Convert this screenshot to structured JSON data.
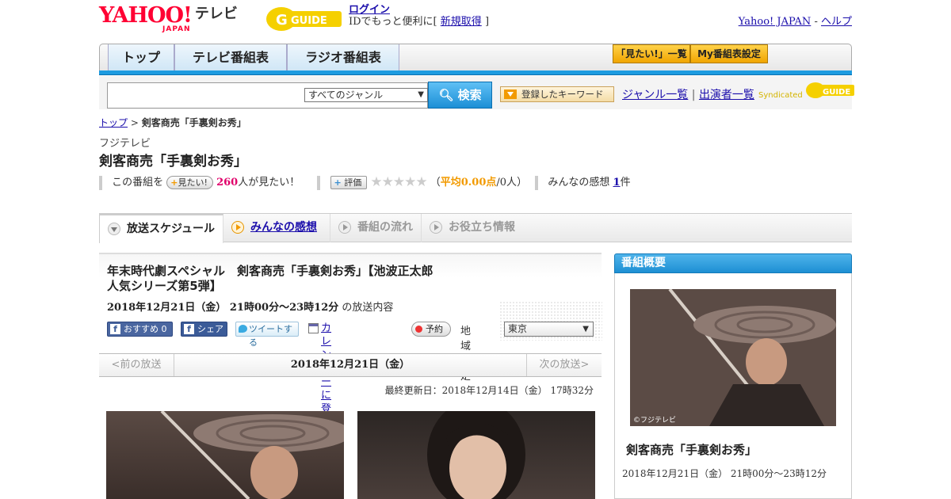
{
  "header": {
    "yahoo_logo": "YAHOO!",
    "yahoo_sub": "JAPAN",
    "tv_label": "テレビ",
    "gguide_logo": "G GUIDE",
    "login_label": "ログイン",
    "login_note_prefix": "IDでもっと便利に[",
    "signup_label": "新規取得",
    "login_note_suffix": "]",
    "yahoo_japan_link": "Yahoo! JAPAN",
    "link_separator": "-",
    "help_link": "ヘルプ"
  },
  "nav": {
    "tabs": [
      "トップ",
      "テレビ番組表",
      "ラジオ番組表"
    ],
    "want_list": "「見たい!」一覧",
    "my_schedule": "My番組表設定"
  },
  "search": {
    "placeholder": "",
    "genre_selected": "すべてのジャンル",
    "search_button": "検索",
    "keyword_button": "登録したキーワード",
    "genre_list_link": "ジャンル一覧",
    "divider": "|",
    "cast_list_link": "出演者一覧",
    "syndicated_label": "Syndicated",
    "syndicated_logo": "GUIDE"
  },
  "breadcrumb": {
    "home": "トップ",
    "separator": ">",
    "current": "剣客商売「手裏剣お秀」"
  },
  "program": {
    "station": "フジテレビ",
    "title": "剣客商売「手裏剣お秀」",
    "want_prefix": "この番組を",
    "want_button": "見たい!",
    "want_count": "260",
    "want_suffix": "人が見たい！",
    "rate_button": "評価",
    "stars": "★★★★★",
    "rating_open": "（",
    "rating_avg": "平均0.00点",
    "rating_count": "/0人",
    "rating_close": "）",
    "impressions_label": "みんなの感想",
    "impressions_count": "1",
    "impressions_unit": "件"
  },
  "tabs": [
    {
      "label": "放送スケジュール"
    },
    {
      "label": "みんなの感想"
    },
    {
      "label": "番組の流れ"
    },
    {
      "label": "お役立ち情報"
    }
  ],
  "broadcast": {
    "title_line1": "年末時代劇スペシャル　剣客商売「手裏剣お秀」【池波正太郎",
    "title_line2": "人気シリーズ第5弾】",
    "datetime": "2018年12月21日（金）  21時00分～23時12分",
    "suffix": "の放送内容",
    "fb_recommend": "おすすめ 0",
    "fb_share": "シェア",
    "tweet": "ツイートする",
    "calendar": "カレンダーに登録",
    "reserve": "予約",
    "region_label": "地域設定",
    "region_selected": "東京",
    "prev": "<前の放送",
    "current_date": "2018年12月21日（金）",
    "next": "次の放送>",
    "updated": "最終更新日：2018年12月14日（金） 17時32分"
  },
  "sidebar": {
    "heading": "番組概要",
    "photo_credit": "©フジテレビ",
    "title": "剣客商売「手裏剣お秀」",
    "time": "2018年12月21日（金） 21時00分～23時12分"
  }
}
